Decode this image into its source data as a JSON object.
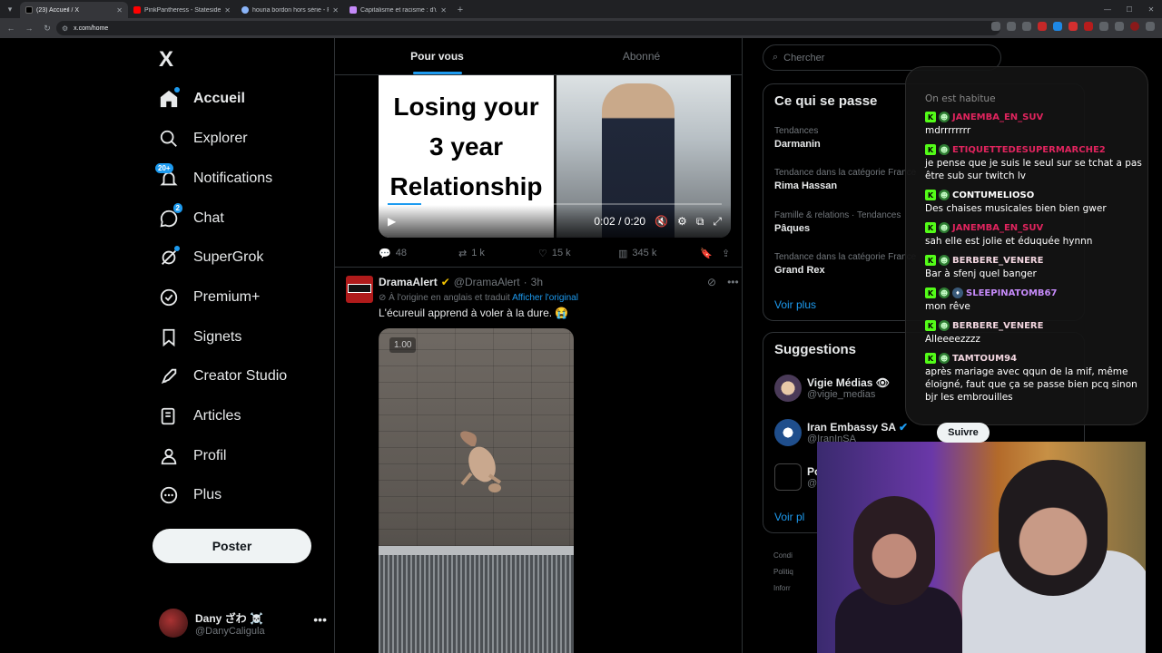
{
  "browser": {
    "tabs": [
      {
        "label": "(23) Accueil / X",
        "color": "#e8eaed"
      },
      {
        "label": "PinkPantheress - Stateside + Z...",
        "color": "#ff3b3b"
      },
      {
        "label": "houria bordon hors série - Rech...",
        "color": "#8ab4f8"
      },
      {
        "label": "Capitalisme et racisme : d'une...",
        "color": "#c58af9"
      }
    ],
    "url": "x.com/home"
  },
  "sidebar": {
    "logo": "X",
    "items": [
      {
        "label": "Accueil"
      },
      {
        "label": "Explorer"
      },
      {
        "label": "Notifications",
        "badge": "20+"
      },
      {
        "label": "Chat",
        "badge": "2"
      },
      {
        "label": "SuperGrok"
      },
      {
        "label": "Premium+"
      },
      {
        "label": "Signets"
      },
      {
        "label": "Creator Studio"
      },
      {
        "label": "Articles"
      },
      {
        "label": "Profil"
      },
      {
        "label": "Plus"
      }
    ],
    "post_button": "Poster",
    "user": {
      "name": "Dany ざわ ☠️",
      "handle": "@DanyCaligula"
    }
  },
  "feed": {
    "tabs": [
      "Pour vous",
      "Abonné"
    ],
    "tweet1": {
      "video_text": [
        "Losing your",
        "3 year",
        "Relationship"
      ],
      "time": "0:02 / 0:20",
      "progress": 0.1,
      "replies": "48",
      "reposts": "1 k",
      "likes": "15 k",
      "views": "345 k"
    },
    "tweet2": {
      "name": "DramaAlert",
      "handle": "@DramaAlert",
      "time": "3h",
      "translated": "À l'origine en anglais et traduit",
      "show_original": "Afficher l'original",
      "text": "L'écureuil apprend à voler à la dure. 😭",
      "speed": "1.00"
    }
  },
  "right": {
    "search_placeholder": "Chercher",
    "trends_title": "Ce qui se passe",
    "trends": [
      {
        "category": "Tendances",
        "title": "Darmanin"
      },
      {
        "category": "Tendance dans la catégorie France",
        "title": "Rima Hassan"
      },
      {
        "category": "Famille & relations · Tendances",
        "title": "Pâques"
      },
      {
        "category": "Tendance dans la catégorie France",
        "title": "Grand Rex"
      }
    ],
    "trends_more": "Voir plus",
    "suggestions_title": "Suggestions",
    "suggestions": [
      {
        "name": "Vigie Médias 👁",
        "handle": "@vigie_medias"
      },
      {
        "name": "Iran Embassy SA",
        "handle": "@IranInSA"
      },
      {
        "name": "Po",
        "handle": "@"
      }
    ],
    "follow_label": "Suivre",
    "suggestions_more": "Voir pl",
    "footer": [
      "Condi",
      "Politiq",
      "Inforr"
    ]
  },
  "chat_overlay": {
    "messages": [
      {
        "user": "",
        "text": "On est habitue",
        "color": "#aaaaaa"
      },
      {
        "user": "JANEMBA_EN_SUV",
        "text": "mdrrrrrrrr",
        "color": "#e0245e"
      },
      {
        "user": "ETIQUETTEDESUPERMARCHE2",
        "text": "je pense que je suis le seul sur se tchat a pas être sub sur twitch lv",
        "color": "#e0245e"
      },
      {
        "user": "CONTUMELIOSO",
        "text": "Des chaises musicales bien bien gwer",
        "color": "#ffffff"
      },
      {
        "user": "JANEMBA_EN_SUV",
        "text": "sah elle est jolie et éduquée hynnn",
        "color": "#e0245e"
      },
      {
        "user": "BERBERE_VENERE",
        "text": "Bar à sfenj quel banger",
        "color": "#f3d6e0"
      },
      {
        "user": "SLEEPINATOMB67",
        "text": "mon rêve",
        "color": "#c58af9"
      },
      {
        "user": "BERBERE_VENERE",
        "text": "Alleeeezzzz",
        "color": "#f3d6e0"
      },
      {
        "user": "TAMTOUM94",
        "text": "après mariage avec qqun de la mif, même éloigné, faut que ça se passe bien pcq sinon bjr les embrouilles",
        "color": "#f3d6e0"
      }
    ]
  }
}
